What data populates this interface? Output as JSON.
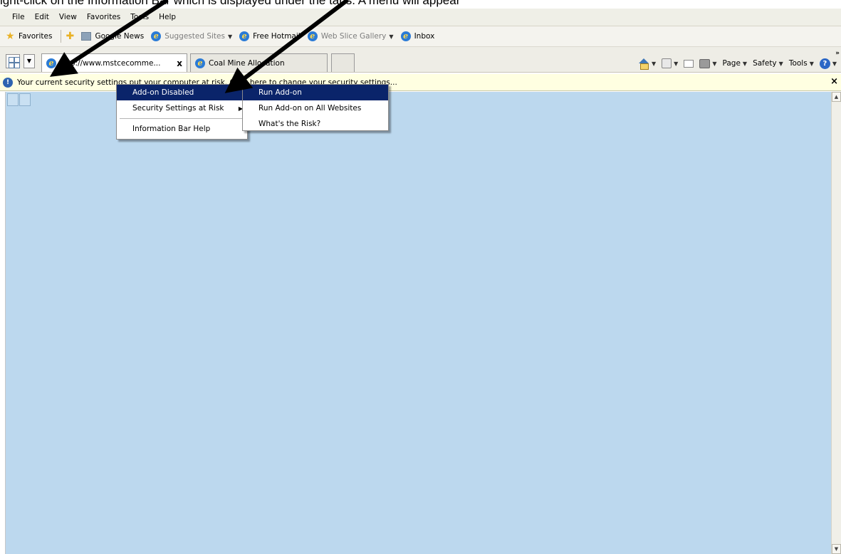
{
  "caption": "ight-click on the Information Bar which is displayed under the tabs.  A menu will appear",
  "menu_bar": [
    "File",
    "Edit",
    "View",
    "Favorites",
    "Tools",
    "Help"
  ],
  "favorites_bar": {
    "favorites_label": "Favorites",
    "items": [
      {
        "label": "Google News",
        "icon": "news-icon",
        "dim": false,
        "dropdown": false
      },
      {
        "label": "Suggested Sites",
        "icon": "ie-icon",
        "dim": true,
        "dropdown": true
      },
      {
        "label": "Free Hotmail",
        "icon": "ie-icon",
        "dim": false,
        "dropdown": false
      },
      {
        "label": "Web Slice Gallery",
        "icon": "ie-icon",
        "dim": true,
        "dropdown": true
      },
      {
        "label": "Inbox",
        "icon": "ie-icon",
        "dim": false,
        "dropdown": false
      }
    ]
  },
  "tabs": {
    "active": {
      "label": "http://www.mstcecomme...",
      "close": "x"
    },
    "inactive": {
      "label": "Coal Mine Allocation"
    }
  },
  "command_bar": {
    "page": "Page",
    "safety": "Safety",
    "tools": "Tools"
  },
  "info_bar": {
    "text": "Your current security settings put your computer at risk. Click here to change your security settings...",
    "close": "×"
  },
  "context_menu": {
    "items": [
      {
        "label": "Add-on Disabled",
        "selected": true,
        "submenu": false
      },
      {
        "label": "Security Settings at Risk",
        "selected": false,
        "submenu": true
      },
      {
        "label": "Information Bar Help",
        "selected": false,
        "submenu": false
      }
    ]
  },
  "submenu": {
    "items": [
      {
        "label": "Run Add-on",
        "selected": true
      },
      {
        "label": "Run Add-on on All Websites",
        "selected": false
      },
      {
        "label": "What's the Risk?",
        "selected": false
      }
    ]
  },
  "colors": {
    "content_bg": "#bcd8ee",
    "info_bar_bg": "#ffffe1",
    "menu_highlight": "#0a246a",
    "arrow": "#000000"
  }
}
